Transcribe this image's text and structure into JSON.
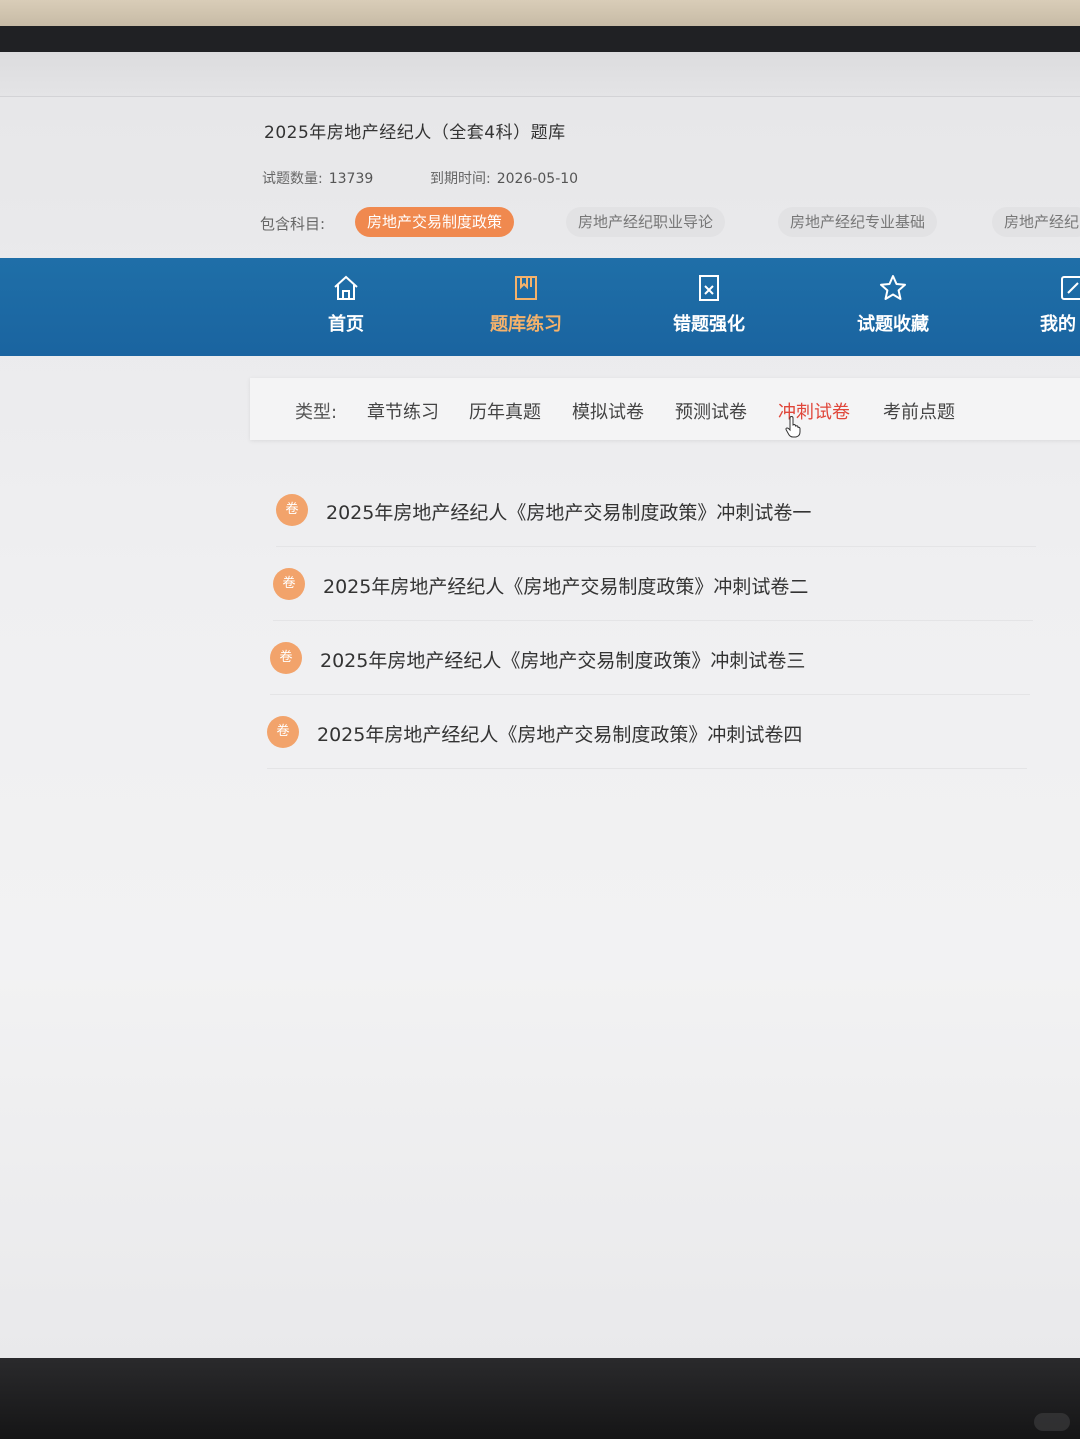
{
  "course": {
    "title": "2025年房地产经纪人（全套4科）题库",
    "question_count_label": "试题数量:",
    "question_count": "13739",
    "expire_label": "到期时间:",
    "expire_date": "2026-05-10",
    "subjects_label": "包含科目:",
    "subjects": [
      "房地产交易制度政策",
      "房地产经纪职业导论",
      "房地产经纪专业基础",
      "房地产经纪"
    ]
  },
  "nav": {
    "items": [
      {
        "label": "首页",
        "icon": "home-icon"
      },
      {
        "label": "题库练习",
        "icon": "book-icon"
      },
      {
        "label": "错题强化",
        "icon": "wrong-question-icon"
      },
      {
        "label": "试题收藏",
        "icon": "star-icon"
      },
      {
        "label": "我的",
        "icon": "edit-icon"
      }
    ],
    "active": "题库练习"
  },
  "types": {
    "label": "类型:",
    "items": [
      "章节练习",
      "历年真题",
      "模拟试卷",
      "预测试卷",
      "冲刺试卷",
      "考前点题"
    ],
    "active": "冲刺试卷"
  },
  "papers": {
    "badge": "卷",
    "items": [
      "2025年房地产经纪人《房地产交易制度政策》冲刺试卷一",
      "2025年房地产经纪人《房地产交易制度政策》冲刺试卷二",
      "2025年房地产经纪人《房地产交易制度政策》冲刺试卷三",
      "2025年房地产经纪人《房地产交易制度政策》冲刺试卷四"
    ]
  },
  "colors": {
    "nav_bg": "#1a64a0",
    "accent_orange": "#f0894f",
    "badge_orange": "#f2a36b",
    "active_type_red": "#e0463a",
    "active_nav_label": "#f5b26b"
  }
}
